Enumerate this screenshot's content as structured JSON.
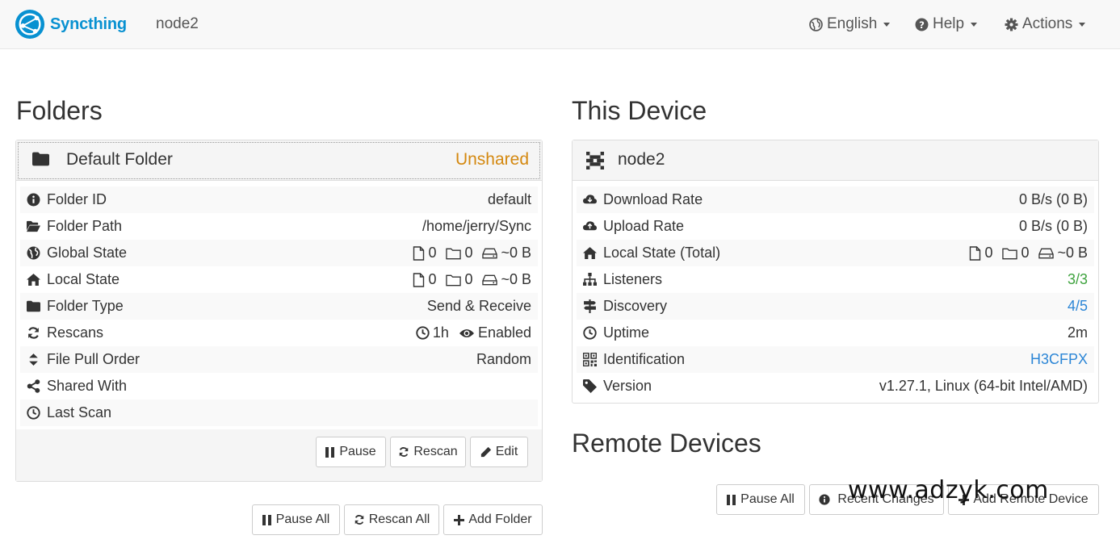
{
  "brand": {
    "name": "Syncthing"
  },
  "header": {
    "device_name": "node2"
  },
  "nav": {
    "language": "English",
    "help": "Help",
    "actions": "Actions"
  },
  "folders": {
    "title": "Folders",
    "folder": {
      "name": "Default Folder",
      "status": "Unshared",
      "rows": [
        {
          "label": "Folder ID",
          "value": "default"
        },
        {
          "label": "Folder Path",
          "value": "/home/jerry/Sync"
        },
        {
          "label": "Global State",
          "files": "0",
          "dirs": "0",
          "size": "~0 B"
        },
        {
          "label": "Local State",
          "files": "0",
          "dirs": "0",
          "size": "~0 B"
        },
        {
          "label": "Folder Type",
          "value": "Send & Receive"
        },
        {
          "label": "Rescans",
          "interval": "1h",
          "watch": "Enabled"
        },
        {
          "label": "File Pull Order",
          "value": "Random"
        },
        {
          "label": "Shared With",
          "value": ""
        },
        {
          "label": "Last Scan",
          "value": ""
        }
      ],
      "buttons": {
        "pause": "Pause",
        "rescan": "Rescan",
        "edit": "Edit"
      }
    },
    "buttons": {
      "pause_all": "Pause All",
      "rescan_all": "Rescan All",
      "add_folder": "Add Folder"
    }
  },
  "this_device": {
    "title": "This Device",
    "name": "node2",
    "rows": [
      {
        "label": "Download Rate",
        "value": "0 B/s (0 B)"
      },
      {
        "label": "Upload Rate",
        "value": "0 B/s (0 B)"
      },
      {
        "label": "Local State (Total)",
        "files": "0",
        "dirs": "0",
        "size": "~0 B"
      },
      {
        "label": "Listeners",
        "value": "3/3"
      },
      {
        "label": "Discovery",
        "value": "4/5"
      },
      {
        "label": "Uptime",
        "value": "2m"
      },
      {
        "label": "Identification",
        "value": "H3CFPX"
      },
      {
        "label": "Version",
        "value": "v1.27.1, Linux (64-bit Intel/AMD)"
      }
    ]
  },
  "remote_devices": {
    "title": "Remote Devices",
    "buttons": {
      "pause_all": "Pause All",
      "recent_changes": "Recent Changes",
      "add_remote": "Add Remote Device"
    }
  },
  "watermark": "www.adzyk.com",
  "colors": {
    "brand": "#0891d1",
    "unshared": "#d4880f",
    "ok": "#3fa33f",
    "link": "#2c86d6"
  }
}
